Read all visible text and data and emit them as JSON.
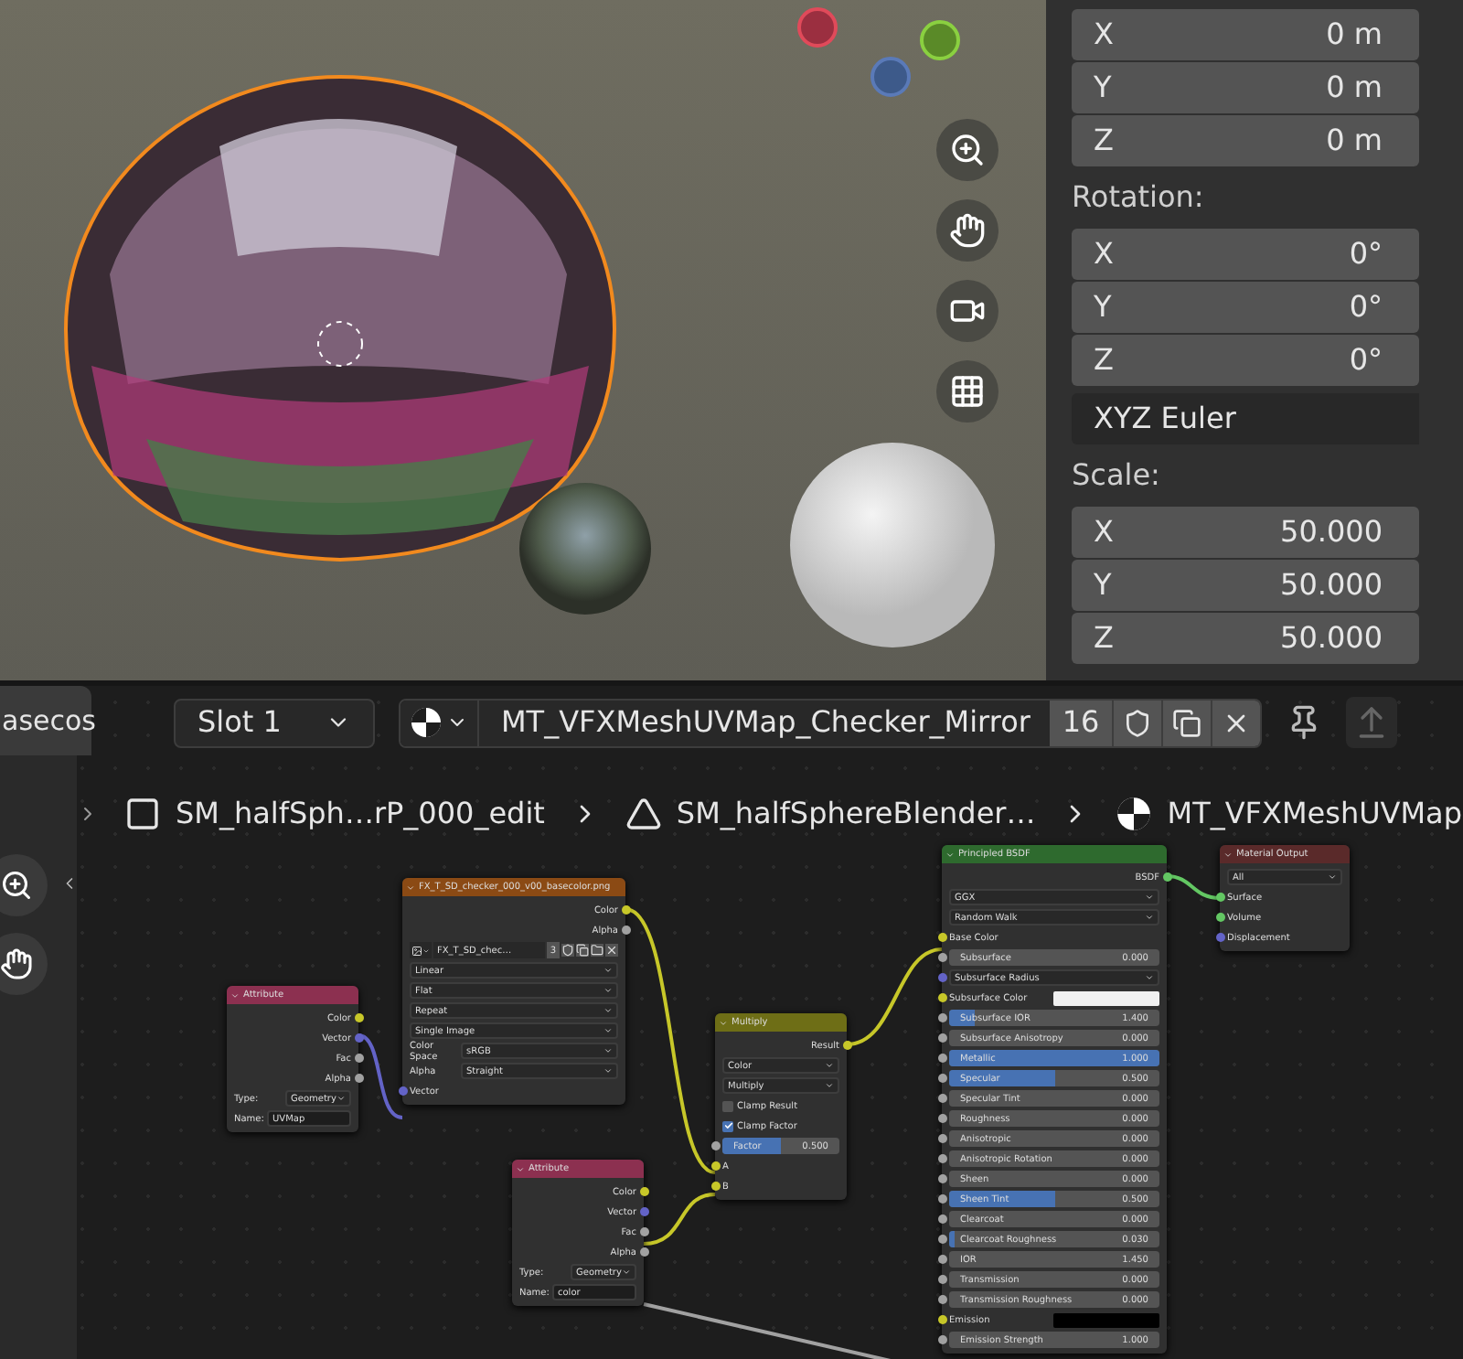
{
  "properties": {
    "location": [
      {
        "axis": "X",
        "value": "0 m"
      },
      {
        "axis": "Y",
        "value": "0 m"
      },
      {
        "axis": "Z",
        "value": "0 m"
      }
    ],
    "rotation_label": "Rotation:",
    "rotation": [
      {
        "axis": "X",
        "value": "0°"
      },
      {
        "axis": "Y",
        "value": "0°"
      },
      {
        "axis": "Z",
        "value": "0°"
      }
    ],
    "rotation_mode": "XYZ Euler",
    "scale_label": "Scale:",
    "scale": [
      {
        "axis": "X",
        "value": "50.000"
      },
      {
        "axis": "Y",
        "value": "50.000"
      },
      {
        "axis": "Z",
        "value": "50.000"
      }
    ]
  },
  "node_editor": {
    "side_tab": "asecos",
    "slot": "Slot 1",
    "material": "MT_VFXMeshUVMap_Checker_Mirror",
    "users": "16",
    "breadcrumbs": [
      {
        "kind": "object",
        "label": "SM_halfSph…rP_000_edit"
      },
      {
        "kind": "mesh",
        "label": "SM_halfSphereBlender…"
      },
      {
        "kind": "material",
        "label": "MT_VFXMeshUVMap"
      }
    ],
    "nodes": [
      {
        "title": "Attribute",
        "color": "#8c3050",
        "rows": [
          {
            "kind": "output",
            "label": "Color",
            "color": "#c7c729"
          },
          {
            "kind": "output",
            "label": "Vector",
            "color": "#6363c7"
          },
          {
            "kind": "output",
            "label": "Fac",
            "color": "#a1a1a1"
          },
          {
            "kind": "output",
            "label": "Alpha",
            "color": "#a1a1a1"
          },
          {
            "kind": "labeled_dropdown",
            "label": "Type:",
            "value": "Geometry"
          },
          {
            "kind": "text_field",
            "label": "Name:",
            "value": "UVMap"
          }
        ]
      },
      {
        "title": "FX_T_SD_checker_000_v00_basecolor.png",
        "color": "#8b4a14",
        "rows": [
          {
            "kind": "output",
            "label": "Color",
            "color": "#c7c729"
          },
          {
            "kind": "output",
            "label": "Alpha",
            "color": "#a1a1a1"
          },
          {
            "kind": "image_bar",
            "value": "FX_T_SD_chec…",
            "users": "3"
          },
          {
            "kind": "dropdown",
            "value": "Linear"
          },
          {
            "kind": "dropdown",
            "value": "Flat"
          },
          {
            "kind": "dropdown",
            "value": "Repeat"
          },
          {
            "kind": "dropdown",
            "value": "Single Image"
          },
          {
            "kind": "labeled_dropdown",
            "label": "Color Space",
            "value": "sRGB"
          },
          {
            "kind": "labeled_dropdown",
            "label": "Alpha",
            "value": "Straight"
          },
          {
            "kind": "input",
            "label": "Vector",
            "color": "#6363c7"
          }
        ]
      },
      {
        "title": "Multiply",
        "color": "#6e6e16",
        "rows": [
          {
            "kind": "output",
            "label": "Result",
            "color": "#c7c729"
          },
          {
            "kind": "dropdown",
            "value": "Color"
          },
          {
            "kind": "dropdown",
            "value": "Multiply"
          },
          {
            "kind": "checkbox",
            "label": "Clamp Result",
            "checked": false
          },
          {
            "kind": "checkbox",
            "label": "Clamp Factor",
            "checked": true
          },
          {
            "kind": "slider",
            "label": "Factor",
            "value": "0.500",
            "level": 0.5,
            "color": "#a1a1a1"
          },
          {
            "kind": "input",
            "label": "A",
            "color": "#c7c729"
          },
          {
            "kind": "input",
            "label": "B",
            "color": "#c7c729"
          }
        ]
      },
      {
        "title": "Attribute",
        "color": "#8c3050",
        "rows": [
          {
            "kind": "output",
            "label": "Color",
            "color": "#c7c729"
          },
          {
            "kind": "output",
            "label": "Vector",
            "color": "#6363c7"
          },
          {
            "kind": "output",
            "label": "Fac",
            "color": "#a1a1a1"
          },
          {
            "kind": "output",
            "label": "Alpha",
            "color": "#a1a1a1"
          },
          {
            "kind": "labeled_dropdown",
            "label": "Type:",
            "value": "Geometry"
          },
          {
            "kind": "text_field",
            "label": "Name:",
            "value": "color"
          }
        ]
      },
      {
        "title": "Principled BSDF",
        "color": "#2e6a2e",
        "rows": [
          {
            "kind": "output",
            "label": "BSDF",
            "color": "#63c763"
          },
          {
            "kind": "dropdown",
            "value": "GGX"
          },
          {
            "kind": "dropdown",
            "value": "Random Walk"
          },
          {
            "kind": "input",
            "label": "Base Color",
            "color": "#c7c729"
          },
          {
            "kind": "slider",
            "label": "Subsurface",
            "value": "0.000",
            "color": "#a1a1a1"
          },
          {
            "kind": "dropdown",
            "value": "Subsurface Radius",
            "color": "#6363c7"
          },
          {
            "kind": "color_input",
            "label": "Subsurface Color",
            "color": "#f0f0f0"
          },
          {
            "kind": "slider",
            "label": "Subsurface IOR",
            "value": "1.400",
            "level": 0.12,
            "color": "#a1a1a1"
          },
          {
            "kind": "slider",
            "label": "Subsurface Anisotropy",
            "value": "0.000",
            "color": "#a1a1a1"
          },
          {
            "kind": "slider",
            "label": "Metallic",
            "value": "1.000",
            "level": 1,
            "color": "#a1a1a1"
          },
          {
            "kind": "slider",
            "label": "Specular",
            "value": "0.500",
            "level": 0.5,
            "color": "#a1a1a1"
          },
          {
            "kind": "slider",
            "label": "Specular Tint",
            "value": "0.000",
            "color": "#a1a1a1"
          },
          {
            "kind": "slider",
            "label": "Roughness",
            "value": "0.000",
            "color": "#a1a1a1"
          },
          {
            "kind": "slider",
            "label": "Anisotropic",
            "value": "0.000",
            "color": "#a1a1a1"
          },
          {
            "kind": "slider",
            "label": "Anisotropic Rotation",
            "value": "0.000",
            "color": "#a1a1a1"
          },
          {
            "kind": "slider",
            "label": "Sheen",
            "value": "0.000",
            "color": "#a1a1a1"
          },
          {
            "kind": "slider",
            "label": "Sheen Tint",
            "value": "0.500",
            "level": 0.5,
            "color": "#a1a1a1"
          },
          {
            "kind": "slider",
            "label": "Clearcoat",
            "value": "0.000",
            "color": "#a1a1a1"
          },
          {
            "kind": "slider",
            "label": "Clearcoat Roughness",
            "value": "0.030",
            "level": 0.03,
            "color": "#a1a1a1"
          },
          {
            "kind": "slider",
            "label": "IOR",
            "value": "1.450",
            "color": "#a1a1a1"
          },
          {
            "kind": "slider",
            "label": "Transmission",
            "value": "0.000",
            "color": "#a1a1a1"
          },
          {
            "kind": "slider",
            "label": "Transmission Roughness",
            "value": "0.000",
            "color": "#a1a1a1"
          },
          {
            "kind": "color_input",
            "label": "Emission",
            "color": "#000000"
          },
          {
            "kind": "slider",
            "label": "Emission Strength",
            "value": "1.000",
            "color": "#a1a1a1"
          }
        ]
      },
      {
        "title": "Material Output",
        "color": "#5a2a2a",
        "rows": [
          {
            "kind": "dropdown",
            "value": "All"
          },
          {
            "kind": "input",
            "label": "Surface",
            "color": "#63c763"
          },
          {
            "kind": "input",
            "label": "Volume",
            "color": "#63c763"
          },
          {
            "kind": "input",
            "label": "Displacement",
            "color": "#6363c7"
          }
        ]
      }
    ]
  }
}
